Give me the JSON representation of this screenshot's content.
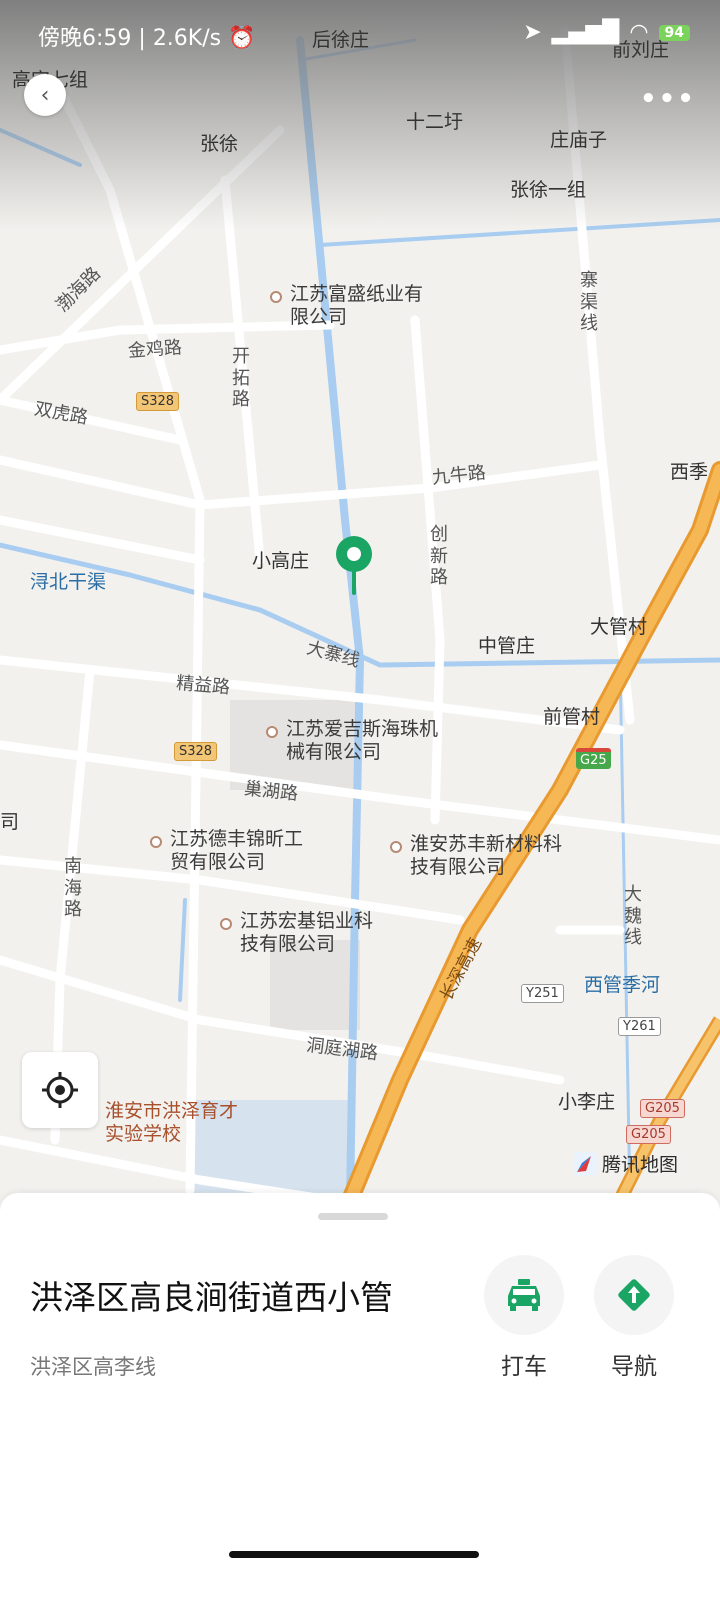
{
  "status_bar": {
    "time": "傍晚6:59",
    "speed": "2.6K/s",
    "battery": "94"
  },
  "map": {
    "place_labels": [
      "高宋七组",
      "张徐",
      "十二圩",
      "庄庙子",
      "张徐一组",
      "前刘庄",
      "后徐庄",
      "小高庄",
      "中管庄",
      "大管村",
      "前管村",
      "西季",
      "小李庄"
    ],
    "water_labels": [
      "浔北干渠",
      "西管季河"
    ],
    "road_labels": [
      "渤海路",
      "金鸡路",
      "开拓路",
      "双虎路",
      "九牛路",
      "创新路",
      "寨渠线",
      "大寨线",
      "精益路",
      "巢湖路",
      "南海路",
      "洞庭湖路",
      "大魏线",
      "长深高速"
    ],
    "pois": [
      "江苏富盛纸业有限公司",
      "江苏爱吉斯海珠机械有限公司",
      "江苏德丰锦昕工贸有限公司",
      "淮安苏丰新材料科技有限公司",
      "江苏宏基铝业科技有限公司",
      "淮安市洪泽育才实验学校"
    ],
    "shields": [
      "S328",
      "S328",
      "G25",
      "Y251",
      "Y261",
      "G205",
      "G205"
    ],
    "edge_label": "司",
    "brand": "腾讯地图"
  },
  "sheet": {
    "title": "洪泽区高良涧街道西小管",
    "subtitle": "洪泽区高李线",
    "actions": [
      {
        "label": "打车",
        "icon": "taxi-icon"
      },
      {
        "label": "导航",
        "icon": "navigation-icon"
      }
    ]
  },
  "colors": {
    "accent": "#1aa564",
    "road": "#ffffff",
    "highway": "#f0a83f",
    "water": "#a9cdf0"
  }
}
